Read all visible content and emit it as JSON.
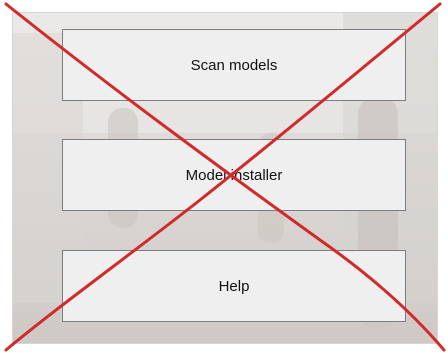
{
  "buttons": {
    "scan_models": "Scan models",
    "model_installer": "Model installer",
    "help": "Help"
  },
  "colors": {
    "cross_stroke": "#d12a2a",
    "button_bg": "#efefef",
    "button_border": "#7d7d7d"
  }
}
